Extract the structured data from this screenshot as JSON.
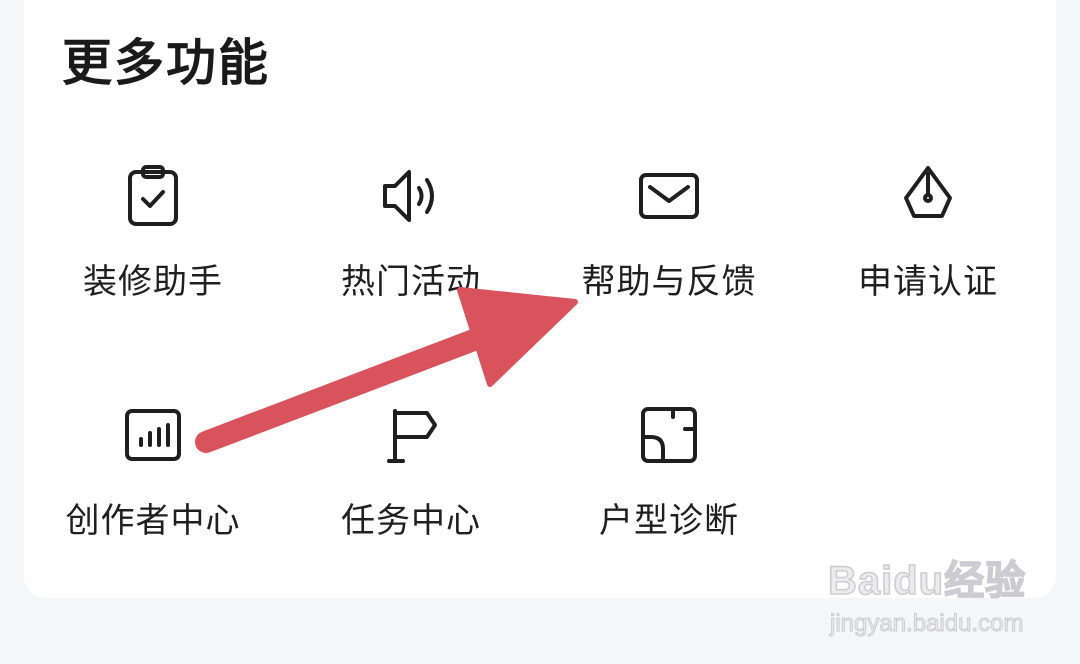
{
  "section": {
    "title": "更多功能"
  },
  "items": [
    {
      "label": "装修助手",
      "icon": "clipboard-check-icon"
    },
    {
      "label": "热门活动",
      "icon": "speaker-icon"
    },
    {
      "label": "帮助与反馈",
      "icon": "mail-icon"
    },
    {
      "label": "申请认证",
      "icon": "pen-nib-icon"
    },
    {
      "label": "创作者中心",
      "icon": "bar-chart-icon"
    },
    {
      "label": "任务中心",
      "icon": "flag-icon"
    },
    {
      "label": "户型诊断",
      "icon": "floor-plan-icon"
    }
  ],
  "annotation": {
    "arrow_color": "#d9535c"
  },
  "watermark": {
    "brand": "Baidu经验",
    "url": "jingyan.baidu.com"
  },
  "colors": {
    "background": "#f5f6f8",
    "card": "#ffffff",
    "icon_stroke": "#1f1f1f",
    "text": "#1a1a1a"
  }
}
